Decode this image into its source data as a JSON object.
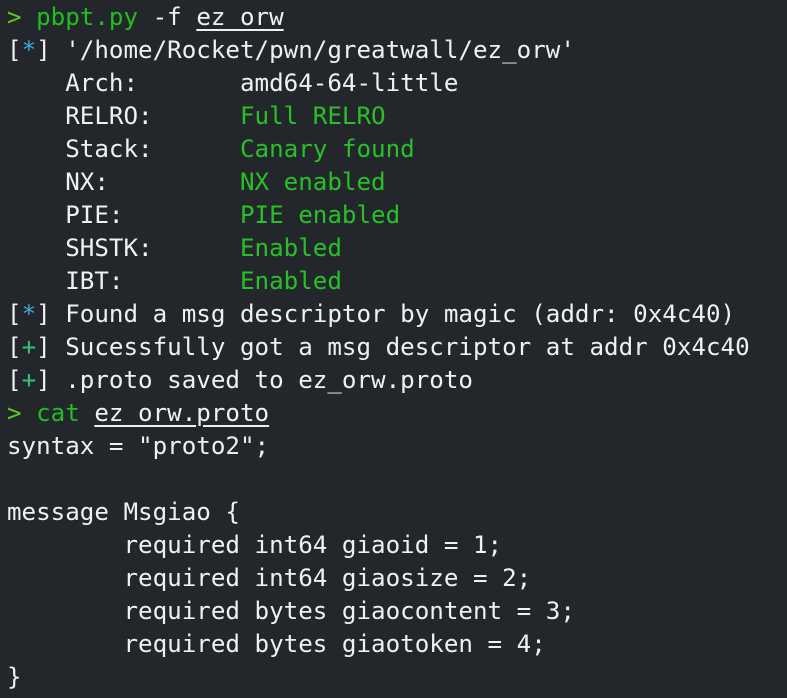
{
  "colors": {
    "background": "#23272c",
    "text": "#eef0f2",
    "prompt": "#5ccc1a",
    "command": "#1fbf1f",
    "info": "#3ea8e0",
    "success": "#2fc27a",
    "enabled": "#27c127"
  },
  "lines": [
    [
      {
        "t": "> ",
        "c": "prompt"
      },
      {
        "t": "pbpt.py",
        "c": "cmd"
      },
      {
        "t": " -f "
      },
      {
        "t": "ez_orw",
        "c": "u"
      }
    ],
    [
      {
        "t": "["
      },
      {
        "t": "*",
        "c": "info"
      },
      {
        "t": "] '/home/Rocket/pwn/greatwall/ez_orw'"
      }
    ],
    [
      {
        "t": "    Arch:       amd64-64-little"
      }
    ],
    [
      {
        "t": "    RELRO:      "
      },
      {
        "t": "Full RELRO",
        "c": "good"
      }
    ],
    [
      {
        "t": "    Stack:      "
      },
      {
        "t": "Canary found",
        "c": "good"
      }
    ],
    [
      {
        "t": "    NX:         "
      },
      {
        "t": "NX enabled",
        "c": "good"
      }
    ],
    [
      {
        "t": "    PIE:        "
      },
      {
        "t": "PIE enabled",
        "c": "good"
      }
    ],
    [
      {
        "t": "    SHSTK:      "
      },
      {
        "t": "Enabled",
        "c": "good"
      }
    ],
    [
      {
        "t": "    IBT:        "
      },
      {
        "t": "Enabled",
        "c": "good"
      }
    ],
    [
      {
        "t": "["
      },
      {
        "t": "*",
        "c": "info"
      },
      {
        "t": "] Found a msg descriptor by magic (addr: 0x4c40)"
      }
    ],
    [
      {
        "t": "["
      },
      {
        "t": "+",
        "c": "ok"
      },
      {
        "t": "] Sucessfully got a msg descriptor at addr 0x4c40"
      }
    ],
    [
      {
        "t": "["
      },
      {
        "t": "+",
        "c": "ok"
      },
      {
        "t": "] .proto saved to ez_orw.proto"
      }
    ],
    [
      {
        "t": "> ",
        "c": "prompt"
      },
      {
        "t": "cat",
        "c": "cmd"
      },
      {
        "t": " "
      },
      {
        "t": "ez_orw.proto",
        "c": "u"
      }
    ],
    [
      {
        "t": "syntax = \"proto2\";"
      }
    ],
    [
      {
        "t": ""
      }
    ],
    [
      {
        "t": "message Msgiao {"
      }
    ],
    [
      {
        "t": "        required int64 giaoid = 1;"
      }
    ],
    [
      {
        "t": "        required int64 giaosize = 2;"
      }
    ],
    [
      {
        "t": "        required bytes giaocontent = 3;"
      }
    ],
    [
      {
        "t": "        required bytes giaotoken = 4;"
      }
    ],
    [
      {
        "t": "}"
      }
    ]
  ]
}
